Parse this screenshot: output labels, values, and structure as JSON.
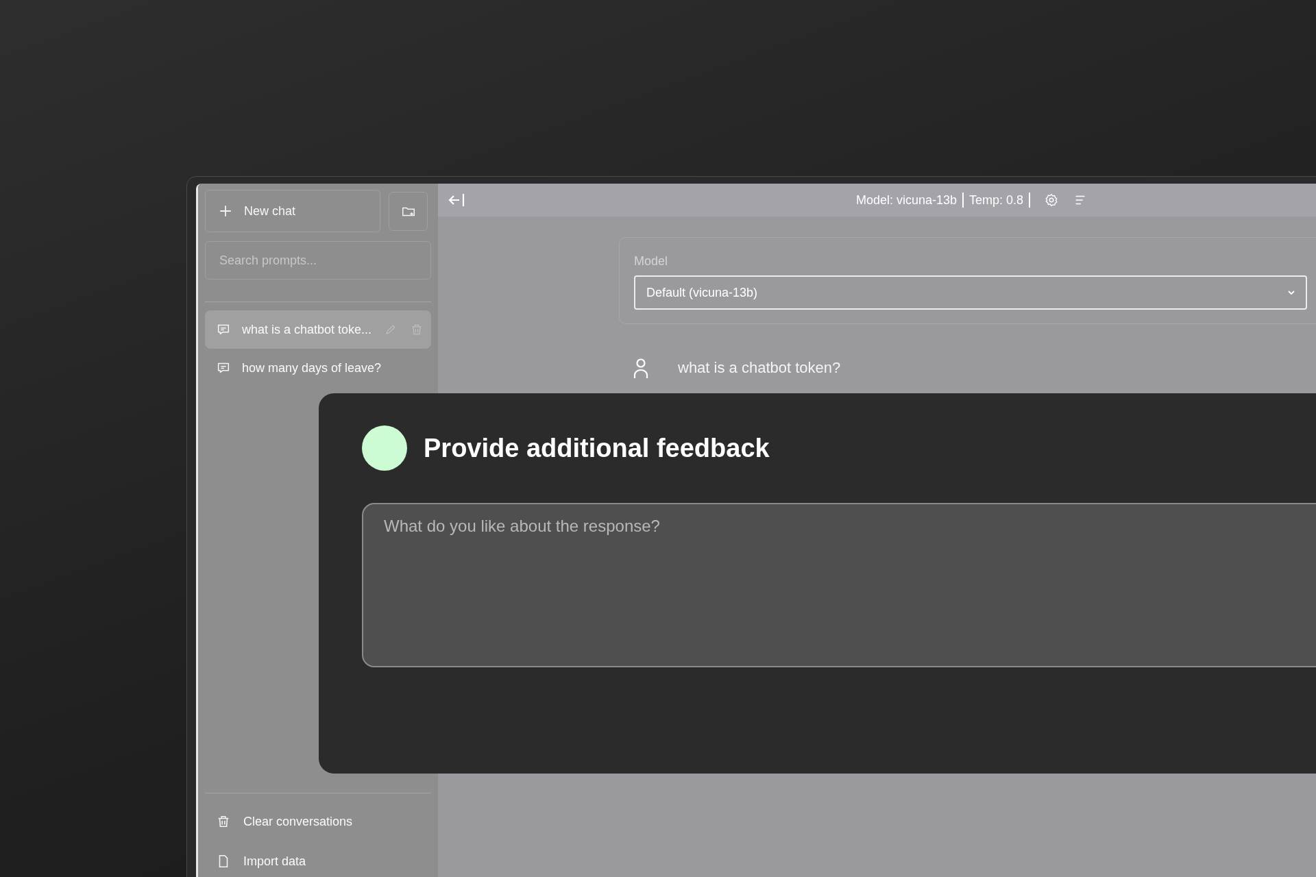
{
  "sidebar": {
    "new_chat_button": "New chat",
    "search": {
      "placeholder": "Search prompts..."
    },
    "conversations": [
      {
        "title": "what is a chatbot toke...",
        "selected": true
      },
      {
        "title": "how many days of leave?",
        "selected": false
      }
    ],
    "footer_items": [
      {
        "label": "Clear conversations",
        "kind": "trash"
      },
      {
        "label": "Import data",
        "kind": "file"
      }
    ]
  },
  "top_bar": {
    "model": "Model: vicuna-13b",
    "temperature": "Temp: 0.8"
  },
  "model_settings": {
    "label": "Model",
    "value": "Default (vicuna-13b)"
  },
  "messages": [
    {
      "kind": "user",
      "text": "what is a chatbot token?"
    }
  ],
  "feedback_dialog": {
    "title": "Provide additional feedback",
    "color": "#cdfbd3",
    "placeholder": "What do you like about the response?"
  }
}
